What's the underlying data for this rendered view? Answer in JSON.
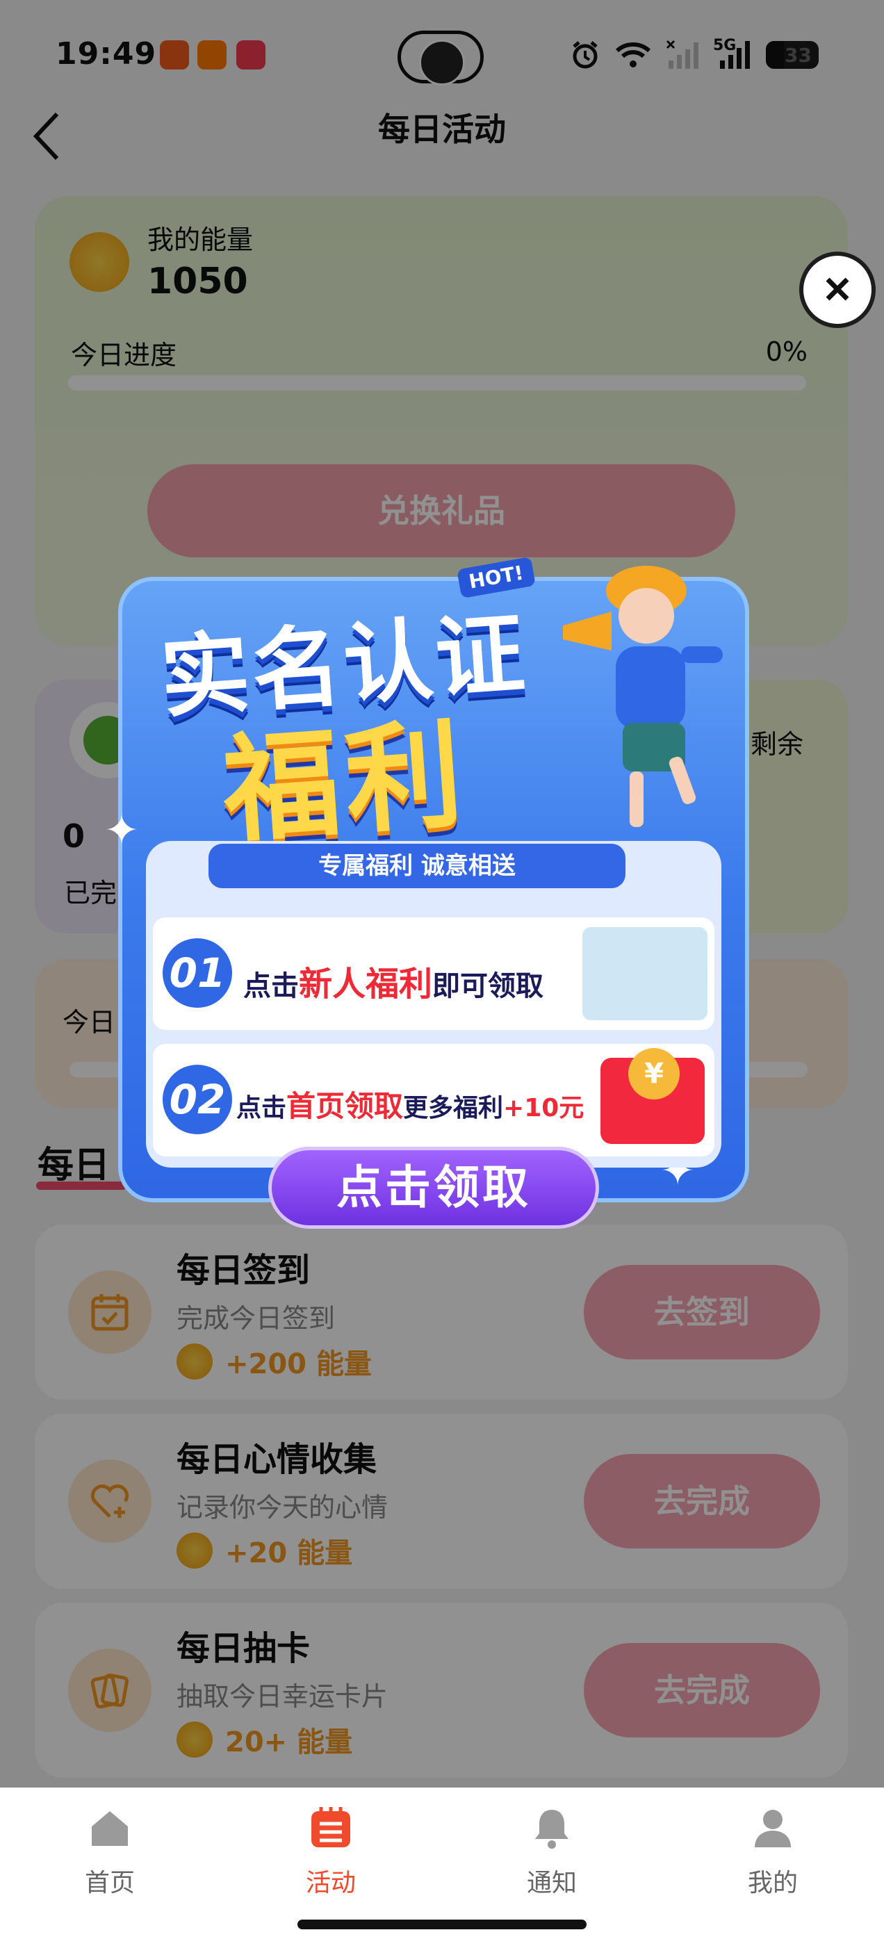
{
  "status_bar": {
    "time": "19:49",
    "battery": "33",
    "signal_5g": "5G"
  },
  "header": {
    "title": "每日活动",
    "back_icon": "chevron-left-icon"
  },
  "energy_card": {
    "label": "我的能量",
    "value": "1050",
    "progress_label": "今日进度",
    "progress_value": "0%",
    "progress_fraction": 0,
    "redeem_button": "兑换礼品"
  },
  "stats": {
    "completed_count": "0",
    "completed_label": "已完",
    "remaining_label": "剩余"
  },
  "today_card": {
    "label": "今日"
  },
  "section": {
    "title": "每日"
  },
  "tasks": [
    {
      "title": "每日签到",
      "desc": "完成今日签到",
      "reward": "+200 能量",
      "button": "去签到",
      "icon": "calendar-check-icon"
    },
    {
      "title": "每日心情收集",
      "desc": "记录你今天的心情",
      "reward": "+20 能量",
      "button": "去完成",
      "icon": "heart-plus-icon"
    },
    {
      "title": "每日抽卡",
      "desc": "抽取今日幸运卡片",
      "reward": "20+ 能量",
      "button": "去完成",
      "icon": "cards-icon"
    }
  ],
  "tabbar": {
    "items": [
      {
        "label": "首页",
        "icon": "home-icon",
        "active": false
      },
      {
        "label": "活动",
        "icon": "calendar-list-icon",
        "active": true
      },
      {
        "label": "通知",
        "icon": "bell-icon",
        "active": false
      },
      {
        "label": "我的",
        "icon": "user-icon",
        "active": false
      }
    ]
  },
  "popup": {
    "hot_tag": "HOT!",
    "headline_1": "实名认证",
    "headline_2": "福利",
    "subtitle": "专属福利 诚意相送",
    "row1": {
      "num": "01",
      "pre": "点击",
      "highlight": "新人福利",
      "post": "即可领取"
    },
    "row2": {
      "num": "02",
      "pre": "点击",
      "highlight": "首页领取",
      "post": "更多福利",
      "bonus": "+10元"
    },
    "claim_button": "点击领取",
    "close_icon": "close-icon"
  },
  "colors": {
    "accent_red": "#f24b6b",
    "tab_active": "#f04a2c",
    "popup_blue": "#2f67e4",
    "claim_purple": "#7a3cf0"
  }
}
